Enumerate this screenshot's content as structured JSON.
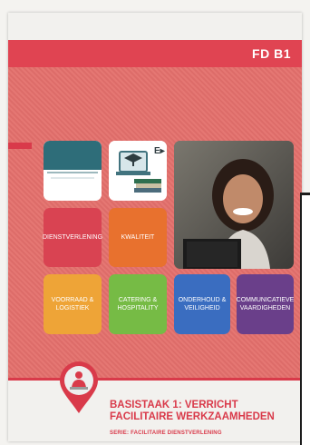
{
  "cover": {
    "code": "FD B1",
    "title": "BASISTAAK 1: VERRICHT FACILITAIRE WERKZAAMHEDEN",
    "series": "SERIE: FACILITAIRE DIENSTVERLENING"
  },
  "tiles": {
    "dienstverlening": "DIENSTVERLENING",
    "kwaliteit": "KWALITEIT",
    "voorraad": "VOORRAAD & LOGISTIEK",
    "catering": "CATERING & HOSPITALITY",
    "onderhoud": "ONDERHOUD & VEILIGHEID",
    "communicatieve": "COMMUNICATIEVE VAARDIGHEDEN"
  },
  "colors": {
    "cover_red": "#e4706c",
    "accent_red": "#d93a4a",
    "dienstverlening": "#d94352",
    "kwaliteit": "#e8712e",
    "voorraad": "#eea437",
    "catering": "#76bb45",
    "onderhoud": "#3a6dc0",
    "communicatieve": "#6a3f8a"
  },
  "icons": [
    "document-teal-icon",
    "laptop-graduation-books-icon",
    "e-learning-arrow-icon",
    "location-pin-icon",
    "worker-person-icon"
  ]
}
